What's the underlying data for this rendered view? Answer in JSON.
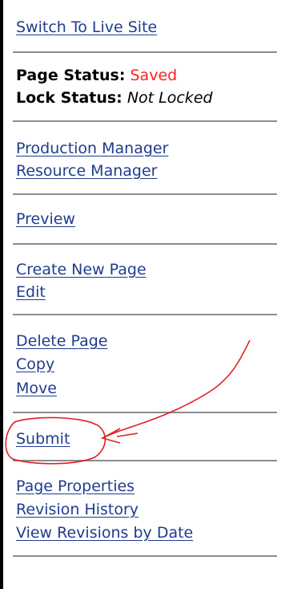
{
  "links": {
    "switch_live": "Switch To Live Site",
    "production_manager": "Production Manager",
    "resource_manager": "Resource Manager",
    "preview": "Preview",
    "create_new_page": "Create New Page",
    "edit": "Edit",
    "delete_page": "Delete Page",
    "copy": "Copy",
    "move": "Move",
    "submit": "Submit",
    "page_properties": "Page Properties",
    "revision_history": "Revision History",
    "view_revisions_by_date": "View Revisions by Date"
  },
  "status": {
    "page_label": "Page Status:",
    "page_value": "Saved",
    "lock_label": "Lock Status:",
    "lock_value": "Not Locked"
  },
  "colors": {
    "link": "#1f3d8f",
    "saved": "#ff2020",
    "annotation": "#e02020"
  }
}
